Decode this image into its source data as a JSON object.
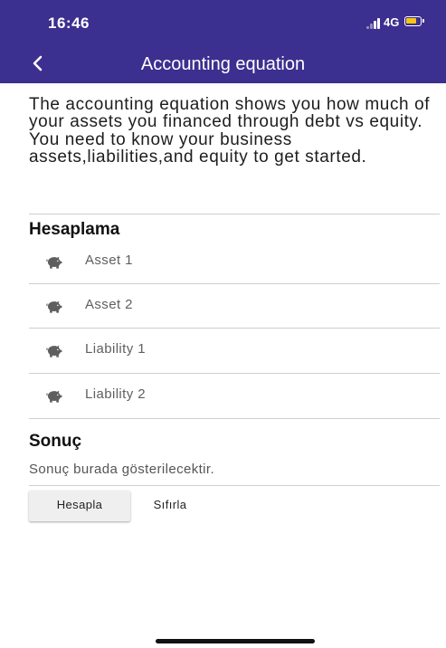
{
  "status_bar": {
    "time": "16:46",
    "network": "4G"
  },
  "app_bar": {
    "title": "Accounting equation"
  },
  "intro_text": "The accounting equation shows you how much of your assets you financed through debt vs equity. You need to know your business assets,liabilities,and equity to get started.",
  "calculation": {
    "heading": "Hesaplama",
    "fields": [
      {
        "placeholder": "Asset 1",
        "icon": "piggy-bank-icon"
      },
      {
        "placeholder": "Asset 2",
        "icon": "piggy-bank-icon"
      },
      {
        "placeholder": "Liability 1",
        "icon": "piggy-bank-icon"
      },
      {
        "placeholder": "Liability 2",
        "icon": "piggy-bank-icon"
      }
    ]
  },
  "result": {
    "heading": "Sonuç",
    "text": "Sonuç burada gösterilecektir."
  },
  "actions": {
    "calculate_label": "Hesapla",
    "reset_label": "Sıfırla"
  },
  "colors": {
    "primary": "#3b2f8f",
    "battery": "#f5c518",
    "icon": "#5f5f5f"
  }
}
